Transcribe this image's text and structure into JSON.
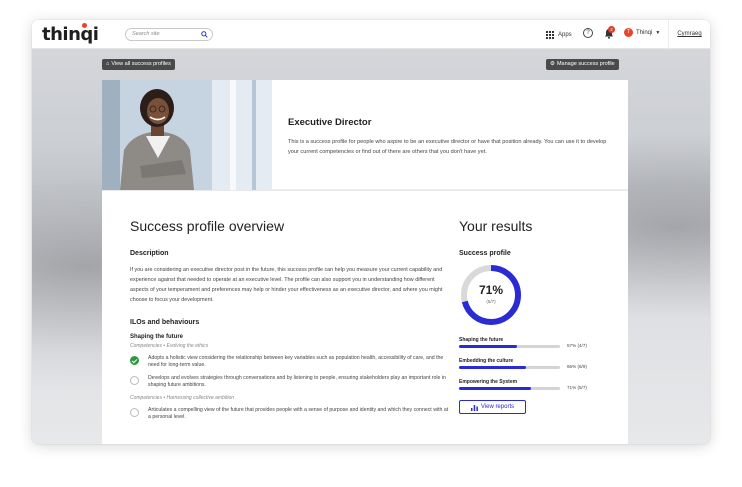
{
  "header": {
    "logo": "thinqi",
    "search_placeholder": "Search site",
    "apps_label": "Apps",
    "notification_count": "2",
    "user_name": "Thinqi",
    "user_initial": "T",
    "language": "Cymraeg"
  },
  "nav": {
    "view_all": "View all success profiles",
    "manage": "Manage success profile"
  },
  "profile": {
    "title": "Executive Director",
    "intro": "This is a success profile for people who aspire to be an executive director or have that position already. You can use it to develop your current competencies or find out of there are others that you don't have yet."
  },
  "overview": {
    "heading": "Success profile overview",
    "description_heading": "Description",
    "description": "If you are considering an executive director post in the future, this success profile can help you measure your current capability and experience against that needed to operate at an executive level. The profile can also support you in understanding how different aspects of your temperament and preferences may help or hinder your effectiveness as an executive director, and where you might choose to focus your development.",
    "ilos_heading": "ILOs and behaviours",
    "section_title": "Shaping the future",
    "category_1": "Competencies • Evolving the ethics",
    "category_2": "Competencies • Harnessing collective ambition",
    "items": [
      {
        "text": "Adopts a holistic view considering the relationship between key variables such as population health, accessibility of care, and the need for long-term value.",
        "done": true
      },
      {
        "text": "Develops and evolves strategies through conversations and by listening to people, ensuring stakeholders play an important role in shaping future ambitions.",
        "done": false
      },
      {
        "text": "Articulates a compelling view of the future that provides people with a sense of purpose and identity and which they connect with at a personal level.",
        "done": false
      }
    ]
  },
  "results": {
    "heading": "Your results",
    "profile_label": "Success profile",
    "percent_label": "71%",
    "fraction_label": "(5/7)",
    "percent_value": 0.71,
    "bars": [
      {
        "label": "Shaping the future",
        "value": 0.57,
        "text": "57% (4/7)"
      },
      {
        "label": "Embedding the culture",
        "value": 0.66,
        "text": "66% (6/9)"
      },
      {
        "label": "Empowering the System",
        "value": 0.71,
        "text": "71% (5/7)"
      }
    ],
    "button_label": "View reports"
  },
  "colors": {
    "accent": "#2b2bd4",
    "brand": "#e8442a",
    "success": "#2c9a3c"
  }
}
